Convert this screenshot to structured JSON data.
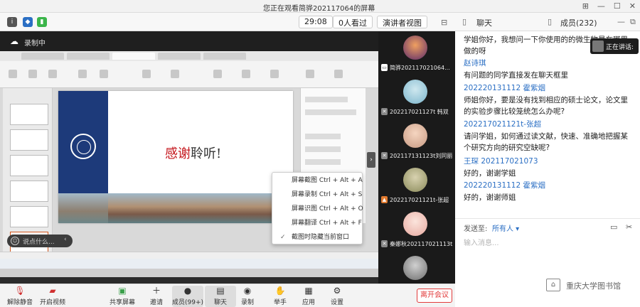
{
  "window": {
    "title": "您正在观看简骅20211706​4的屏幕"
  },
  "toolbar": {
    "timer": "29:08",
    "watching": "0人看过",
    "view_mode": "演讲者视图",
    "signal_color": "#3bb54a"
  },
  "recording": {
    "label": "录制中"
  },
  "slide": {
    "thanks_red": "感谢",
    "thanks_black": "聆听!"
  },
  "context_menu": {
    "items": [
      "屏幕截图 Ctrl + Alt + A",
      "屏幕录制 Ctrl + Alt + S",
      "屏幕识图 Ctrl + Alt + O",
      "屏幕翻译 Ctrl + Alt + F",
      "截图时隐藏当前窗口"
    ]
  },
  "bubble": {
    "placeholder": "说点什么..."
  },
  "participants": [
    {
      "name": "简骅202117021064..."
    },
    {
      "name": "20221702​1127t 韩双"
    },
    {
      "name": "202117131123t刘同丽"
    },
    {
      "name": "20221702​1121t-张超"
    },
    {
      "name": "秦娜秋202117021113t"
    },
    {
      "name": ""
    }
  ],
  "chat": {
    "tab_chat": "聊天",
    "tab_members": "成员(232)",
    "speaking": "正在讲话:",
    "messages": [
      {
        "type": "text",
        "content": "学姐你好，我想问一下你使用的的微生物是在哪里做的呀"
      },
      {
        "type": "sender",
        "content": "赵诗琪"
      },
      {
        "type": "text",
        "content": "有问题的同学直接发在聊天框里"
      },
      {
        "type": "sender",
        "content": "202220131112 霍紫烟"
      },
      {
        "type": "text",
        "content": "师姐你好，要是没有找到相应的硕士论文，论文里的实验步骤比较笼统怎么办呢?"
      },
      {
        "type": "sender",
        "content": "20221702​1121t-张超"
      },
      {
        "type": "text",
        "content": "请问学姐，如何通过读文献，快速、准确地把握某个研究方向的研究空缺呢?"
      },
      {
        "type": "sender",
        "content": "王琛 202117021073"
      },
      {
        "type": "text",
        "content": "好的，谢谢学姐"
      },
      {
        "type": "sender",
        "content": "202220131112 霍紫烟"
      },
      {
        "type": "text",
        "content": "好的，谢谢师姐"
      }
    ],
    "send_to_label": "发送至:",
    "send_to_value": "所有人",
    "input_placeholder": "输入消息..."
  },
  "controls": {
    "mute": "解除静音",
    "video": "开启视频",
    "share": "共享屏幕",
    "invite": "邀请",
    "members": "成员(99+)",
    "chat": "聊天",
    "record": "录制",
    "raise": "举手",
    "apps": "应用",
    "settings": "设置",
    "leave": "离开会议"
  },
  "library": {
    "text": "重庆大学图书馆"
  },
  "colors": {
    "accent_blue": "#2b6fc4",
    "leave_red": "#e23b3b"
  }
}
